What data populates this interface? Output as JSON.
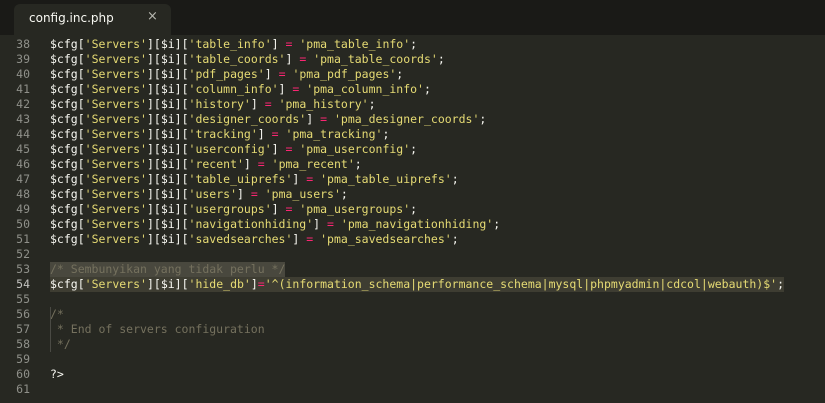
{
  "tab": {
    "title": "config.inc.php",
    "close_glyph": "×"
  },
  "lines": [
    {
      "n": "38",
      "key": "'table_info'",
      "val": "'pma_table_info'"
    },
    {
      "n": "39",
      "key": "'table_coords'",
      "val": "'pma_table_coords'"
    },
    {
      "n": "40",
      "key": "'pdf_pages'",
      "val": "'pma_pdf_pages'"
    },
    {
      "n": "41",
      "key": "'column_info'",
      "val": "'pma_column_info'"
    },
    {
      "n": "42",
      "key": "'history'",
      "val": "'pma_history'"
    },
    {
      "n": "43",
      "key": "'designer_coords'",
      "val": "'pma_designer_coords'"
    },
    {
      "n": "44",
      "key": "'tracking'",
      "val": "'pma_tracking'"
    },
    {
      "n": "45",
      "key": "'userconfig'",
      "val": "'pma_userconfig'"
    },
    {
      "n": "46",
      "key": "'recent'",
      "val": "'pma_recent'"
    },
    {
      "n": "47",
      "key": "'table_uiprefs'",
      "val": "'pma_table_uiprefs'"
    },
    {
      "n": "48",
      "key": "'users'",
      "val": "'pma_users'"
    },
    {
      "n": "49",
      "key": "'usergroups'",
      "val": "'pma_usergroups'"
    },
    {
      "n": "50",
      "key": "'navigationhiding'",
      "val": "'pma_navigationhiding'"
    },
    {
      "n": "51",
      "key": "'savedsearches'",
      "val": "'pma_savedsearches'"
    }
  ],
  "prefix": {
    "var": "$cfg",
    "servers": "'Servers'",
    "i": "$i"
  },
  "line52": "52",
  "line53": {
    "n": "53",
    "comment": "/* Sembunyikan yang tidak perlu */"
  },
  "line54": {
    "n": "54",
    "key": "'hide_db'",
    "val": "'^(information_schema|performance_schema|mysql|phpmyadmin|cdcol|webauth)$'"
  },
  "line55": "55",
  "line56": {
    "n": "56",
    "text": "/*"
  },
  "line57": {
    "n": "57",
    "text": " * End of servers configuration"
  },
  "line58": {
    "n": "58",
    "text": " */"
  },
  "line59": "59",
  "line60": {
    "n": "60",
    "text": "?>"
  },
  "line61": "61"
}
